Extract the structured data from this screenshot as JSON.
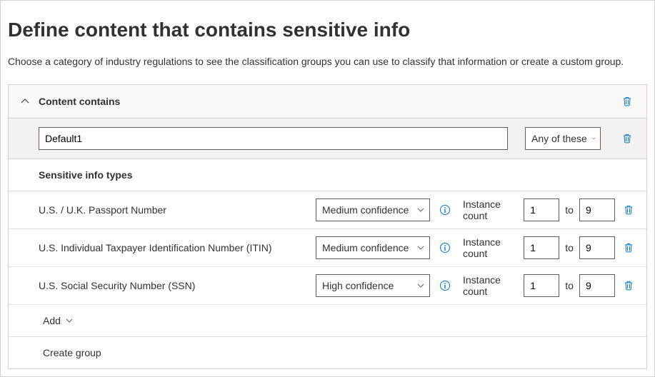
{
  "header": {
    "title": "Define content that contains sensitive info",
    "intro": "Choose a category of industry regulations to see the classification groups you can use to classify that information or create a custom group."
  },
  "panel": {
    "title": "Content contains",
    "group_name": "Default1",
    "match_mode": "Any of these",
    "subheading": "Sensitive info types",
    "rows": [
      {
        "name": "U.S. / U.K. Passport Number",
        "confidence": "Medium confidence",
        "instance_label": "Instance count",
        "from": "1",
        "to_label": "to",
        "to": "9"
      },
      {
        "name": "U.S. Individual Taxpayer Identification Number (ITIN)",
        "confidence": "Medium confidence",
        "instance_label": "Instance count",
        "from": "1",
        "to_label": "to",
        "to": "9"
      },
      {
        "name": "U.S. Social Security Number (SSN)",
        "confidence": "High confidence",
        "instance_label": "Instance count",
        "from": "1",
        "to_label": "to",
        "to": "9"
      }
    ],
    "add_label": "Add",
    "create_group_label": "Create group"
  }
}
